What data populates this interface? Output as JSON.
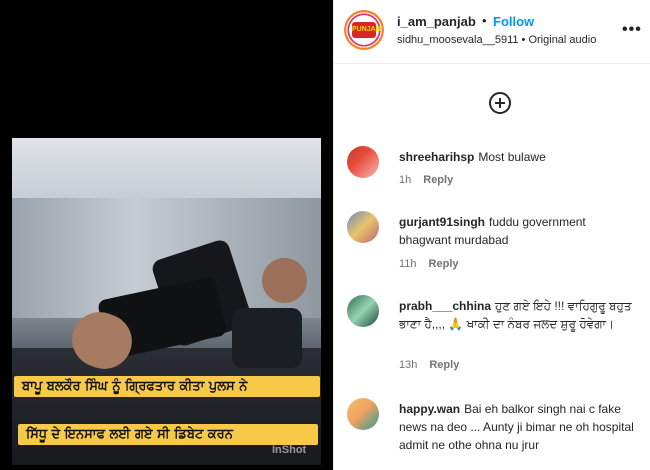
{
  "media": {
    "caption_line1": "ਬਾਪੂ ਬਲਕੌਰ ਸਿੰਘ ਨੂੰ ਗ੍ਰਿਫਤਾਰ ਕੀਤਾ ਪੁਲਸ ਨੇ",
    "caption_line2": "ਸਿੱਧੂ ਦੇ ਇਨਸਾਫ ਲਈ ਗਏ ਸੀ ਡਿਬੇਟ ਕਰਨ",
    "watermark": "InShot"
  },
  "header": {
    "username": "i_am_panjab",
    "separator": "•",
    "follow_label": "Follow",
    "audio": "sidhu_moosevala__5911 • Original audio",
    "more_label": "•••",
    "logo_text": "PUNJAB"
  },
  "comments": [
    {
      "user": "shreeharihsp",
      "text": "Most bulawe",
      "time": "1h",
      "reply": "Reply"
    },
    {
      "user": "gurjant91singh",
      "text": "fuddu government bhagwant murdabad",
      "time": "11h",
      "reply": "Reply"
    },
    {
      "user": "prabh___chhina",
      "text": "ਹੁਣ ਗਏ ਇਹੇ !!! ਵਾਹਿਗੁਰੂ ਬਹੁਤ ਭਾਣਾ ਹੈ,,,, 🙏 ਖਾਕੀ ਦਾ ਨੰਬਰ ਜਲਦ ਸ਼ੁਰੂ ਹੋਵੇਗਾ।",
      "time": "13h",
      "reply": "Reply"
    },
    {
      "user": "happy.wan",
      "text": "Bai eh balkor singh nai c fake news na deo ... Aunty ji bimar ne oh hospital admit ne othe ohna nu jrur",
      "time": "",
      "reply": ""
    }
  ],
  "icons": {
    "add_comment": "plus-circle-icon"
  }
}
